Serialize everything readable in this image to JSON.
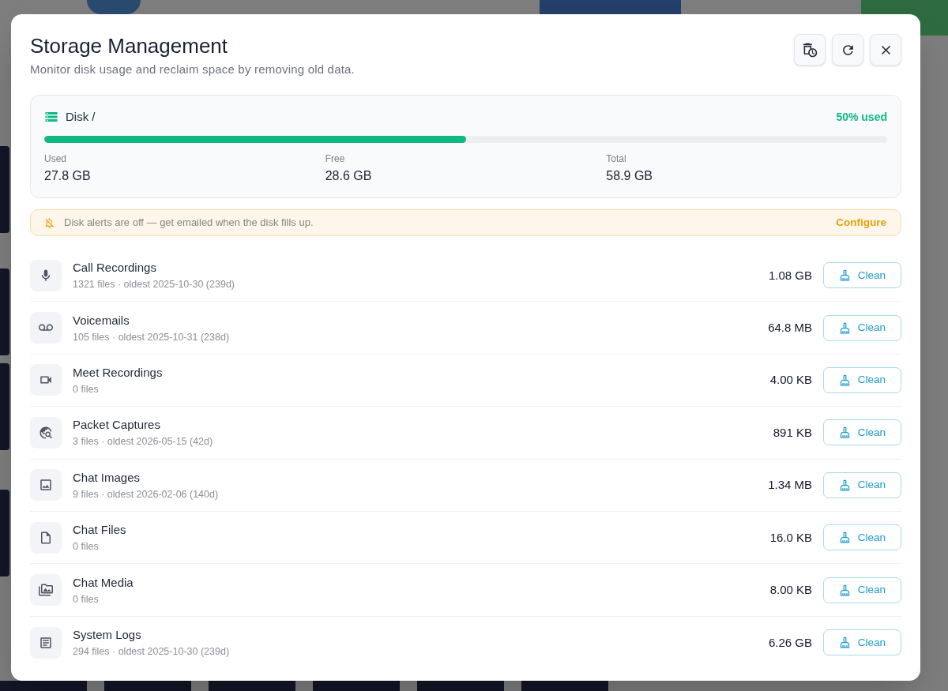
{
  "dialog": {
    "title": "Storage Management",
    "subtitle": "Monitor disk usage and reclaim space by removing old data."
  },
  "disk": {
    "name": "Disk /",
    "usage_label": "50% used",
    "level": 0.5,
    "stats": [
      {
        "label": "Used",
        "value": "27.8 GB"
      },
      {
        "label": "Free",
        "value": "28.6 GB"
      },
      {
        "label": "Total",
        "value": "58.9 GB"
      }
    ]
  },
  "alert": {
    "message": "Disk alerts are off — get emailed when the disk fills up.",
    "action": "Configure"
  },
  "categories": [
    {
      "name": "Call Recordings",
      "meta": "1321 files · oldest 2025-10-30 (239d)",
      "size": "1.08 GB",
      "action": "Clean"
    },
    {
      "name": "Voicemails",
      "meta": "105 files · oldest 2025-10-31 (238d)",
      "size": "64.8 MB",
      "action": "Clean"
    },
    {
      "name": "Meet Recordings",
      "meta": "0 files",
      "size": "4.00 KB",
      "action": "Clean"
    },
    {
      "name": "Packet Captures",
      "meta": "3 files · oldest 2026-05-15 (42d)",
      "size": "891 KB",
      "action": "Clean"
    },
    {
      "name": "Chat Images",
      "meta": "9 files · oldest 2026-02-06 (140d)",
      "size": "1.34 MB",
      "action": "Clean"
    },
    {
      "name": "Chat Files",
      "meta": "0 files",
      "size": "16.0 KB",
      "action": "Clean"
    },
    {
      "name": "Chat Media",
      "meta": "0 files",
      "size": "8.00 KB",
      "action": "Clean"
    },
    {
      "name": "System Logs",
      "meta": "294 files · oldest 2025-10-30 (239d)",
      "size": "6.26 GB",
      "action": "Clean"
    }
  ]
}
